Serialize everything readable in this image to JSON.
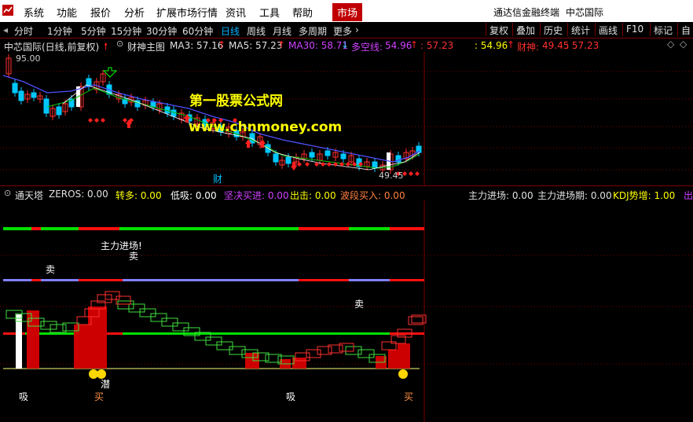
{
  "menubar": {
    "items": [
      "系统",
      "功能",
      "报价",
      "分析",
      "扩展市场行情",
      "资讯",
      "工具",
      "帮助"
    ],
    "active": "市场",
    "app_title": "通达信金融终端",
    "stock_title": "中芯国际"
  },
  "toolbar": {
    "periods": [
      "分时",
      "1分钟",
      "5分钟",
      "15分钟",
      "30分钟",
      "60分钟",
      "日线",
      "周线",
      "月线",
      "多周期",
      "更多"
    ],
    "selected": "日线",
    "right_buttons": [
      "复权",
      "叠加",
      "历史",
      "统计",
      "画线",
      "F10",
      "标记",
      "自"
    ]
  },
  "main_info": {
    "stock": "中芯国际(日线,前复权)",
    "indicator": "财神主图",
    "ma3": "MA3: 57.16",
    "ma5": "MA5: 57.23",
    "ma30": "MA30: 58.71",
    "duokong_label": "多空线:",
    "duokong_value": "54.96",
    "v3": ": 57.23",
    "v4": ": 54.96",
    "caishen_label": "财神:",
    "caishen_value": "49.45",
    "v6": ": 57.23"
  },
  "main_chart": {
    "price_high": "95.00",
    "price_low": "49.45",
    "watermark_cn": "第一股票公式网",
    "watermark_url": "www.chnmoney.com",
    "cai_marker": "财"
  },
  "sub_info": {
    "indicator": "通天塔",
    "zeros": "ZEROS: 0.00",
    "zhuanduo": "转多: 0.00",
    "dixi": "低吸: 0.00",
    "jianjue": "坚决买进: 0.00",
    "chuji": "出击: 0.00",
    "boduan": "波段买入: 0.00",
    "zhuli": "主力进场: 0.00",
    "zhuliqi": "主力进场期: 0.00",
    "kdj": "KDJ势增: 1.00",
    "chu": "出"
  },
  "sub_chart": {
    "zhuli_jinchang": "主力进场!",
    "mai_sell": "卖",
    "xi": "吸",
    "mai_buy": "买",
    "qian": "潜"
  },
  "colors": {
    "up": "#ff3030",
    "down": "#00c8ff",
    "ma_blue": "#5050ff",
    "ma_green": "#00c000",
    "watermark": "#ffff00"
  }
}
